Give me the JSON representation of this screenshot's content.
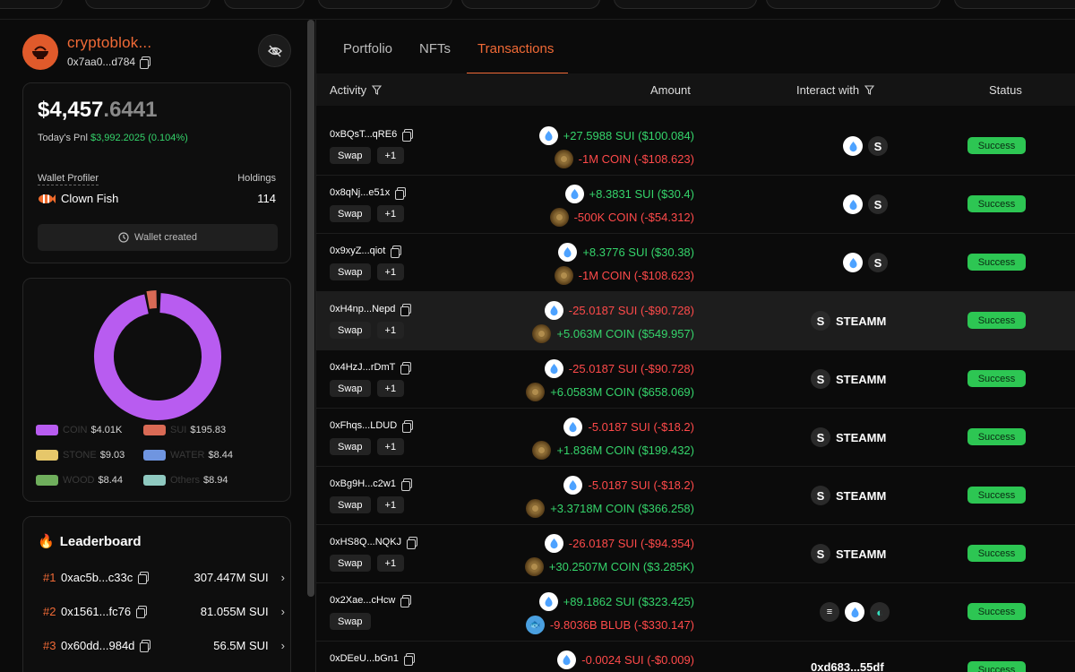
{
  "profile": {
    "name": "cryptoblok...",
    "address": "0x7aa0...d784"
  },
  "balance": {
    "whole": "$4,457",
    "decimal": ".6441",
    "pnl_label": "Today's Pnl",
    "pnl_value": "$3,992.2025 (0.104%)"
  },
  "wallet": {
    "profiler_label": "Wallet Profiler",
    "holdings_label": "Holdings",
    "profile_type": "Clown Fish",
    "holdings_value": "114",
    "created_button": "Wallet created"
  },
  "portfolio_chart": {
    "legend": [
      {
        "name": "COIN",
        "value": "$4.01K",
        "color": "#b85cf0"
      },
      {
        "name": "SUI",
        "value": "$195.83",
        "color": "#d96a55"
      },
      {
        "name": "STONE",
        "value": "$9.03",
        "color": "#e6c76a"
      },
      {
        "name": "WATER",
        "value": "$8.44",
        "color": "#6f95e0"
      },
      {
        "name": "WOOD",
        "value": "$8.44",
        "color": "#6fae5c"
      },
      {
        "name": "Others",
        "value": "$8.94",
        "color": "#8fc9c0"
      }
    ]
  },
  "leaderboard": {
    "title": "Leaderboard",
    "entries": [
      {
        "rank": "#1",
        "address": "0xac5b...c33c",
        "value": "307.447M SUI"
      },
      {
        "rank": "#2",
        "address": "0x1561...fc76",
        "value": "81.055M SUI"
      },
      {
        "rank": "#3",
        "address": "0x60dd...984d",
        "value": "56.5M SUI"
      }
    ]
  },
  "tabs": [
    "Portfolio",
    "NFTs",
    "Transactions"
  ],
  "table": {
    "headers": {
      "activity": "Activity",
      "amount": "Amount",
      "interact": "Interact with",
      "status": "Status"
    },
    "rows": [
      {
        "hash": "0xBQsT...qRE6",
        "tags": [
          "Swap",
          "+1"
        ],
        "a1": "+27.5988 SUI ($100.084)",
        "a1c": "pos",
        "a1i": "sui",
        "a2": "-1M COIN (-$108.623)",
        "a2c": "neg",
        "a2i": "coin",
        "interact": "",
        "icons": [
          "sui",
          "steamm"
        ],
        "status": "Success"
      },
      {
        "hash": "0x8qNj...e51x",
        "tags": [
          "Swap",
          "+1"
        ],
        "a1": "+8.3831 SUI ($30.4)",
        "a1c": "pos",
        "a1i": "sui",
        "a2": "-500K COIN (-$54.312)",
        "a2c": "neg",
        "a2i": "coin",
        "interact": "",
        "icons": [
          "sui",
          "steamm"
        ],
        "status": "Success"
      },
      {
        "hash": "0x9xyZ...qiot",
        "tags": [
          "Swap",
          "+1"
        ],
        "a1": "+8.3776 SUI ($30.38)",
        "a1c": "pos",
        "a1i": "sui",
        "a2": "-1M COIN (-$108.623)",
        "a2c": "neg",
        "a2i": "coin",
        "interact": "",
        "icons": [
          "sui",
          "steamm"
        ],
        "status": "Success"
      },
      {
        "hash": "0xH4np...Nepd",
        "tags": [
          "Swap",
          "+1"
        ],
        "a1": "-25.0187 SUI (-$90.728)",
        "a1c": "neg",
        "a1i": "sui",
        "a2": "+5.063M COIN ($549.957)",
        "a2c": "pos",
        "a2i": "coin",
        "interact": "STEAMM",
        "icons": [
          "steamm"
        ],
        "status": "Success",
        "hl": true
      },
      {
        "hash": "0x4HzJ...rDmT",
        "tags": [
          "Swap",
          "+1"
        ],
        "a1": "-25.0187 SUI (-$90.728)",
        "a1c": "neg",
        "a1i": "sui",
        "a2": "+6.0583M COIN ($658.069)",
        "a2c": "pos",
        "a2i": "coin",
        "interact": "STEAMM",
        "icons": [
          "steamm"
        ],
        "status": "Success"
      },
      {
        "hash": "0xFhqs...LDUD",
        "tags": [
          "Swap",
          "+1"
        ],
        "a1": "-5.0187 SUI (-$18.2)",
        "a1c": "neg",
        "a1i": "sui",
        "a2": "+1.836M COIN ($199.432)",
        "a2c": "pos",
        "a2i": "coin",
        "interact": "STEAMM",
        "icons": [
          "steamm"
        ],
        "status": "Success"
      },
      {
        "hash": "0xBg9H...c2w1",
        "tags": [
          "Swap",
          "+1"
        ],
        "a1": "-5.0187 SUI (-$18.2)",
        "a1c": "neg",
        "a1i": "sui",
        "a2": "+3.3718M COIN ($366.258)",
        "a2c": "pos",
        "a2i": "coin",
        "interact": "STEAMM",
        "icons": [
          "steamm"
        ],
        "status": "Success"
      },
      {
        "hash": "0xHS8Q...NQKJ",
        "tags": [
          "Swap",
          "+1"
        ],
        "a1": "-26.0187 SUI (-$94.354)",
        "a1c": "neg",
        "a1i": "sui",
        "a2": "+30.2507M COIN ($3.285K)",
        "a2c": "pos",
        "a2i": "coin",
        "interact": "STEAMM",
        "icons": [
          "steamm"
        ],
        "status": "Success"
      },
      {
        "hash": "0x2Xae...cHcw",
        "tags": [
          "Swap"
        ],
        "a1": "+89.1862 SUI ($323.425)",
        "a1c": "pos",
        "a1i": "sui",
        "a2": "-9.8036B BLUB (-$330.147)",
        "a2c": "neg",
        "a2i": "blub",
        "interact": "",
        "icons": [
          "dex",
          "sui",
          "bird"
        ],
        "status": "Success"
      },
      {
        "hash": "0xDEeU...bGn1",
        "tags": [],
        "a1": "-0.0024 SUI (-$0.009)",
        "a1c": "neg",
        "a1i": "sui",
        "a2": "",
        "a2c": "neg",
        "a2i": "",
        "interact": "0xd683...55df",
        "icons": [],
        "status": "Success"
      }
    ]
  }
}
